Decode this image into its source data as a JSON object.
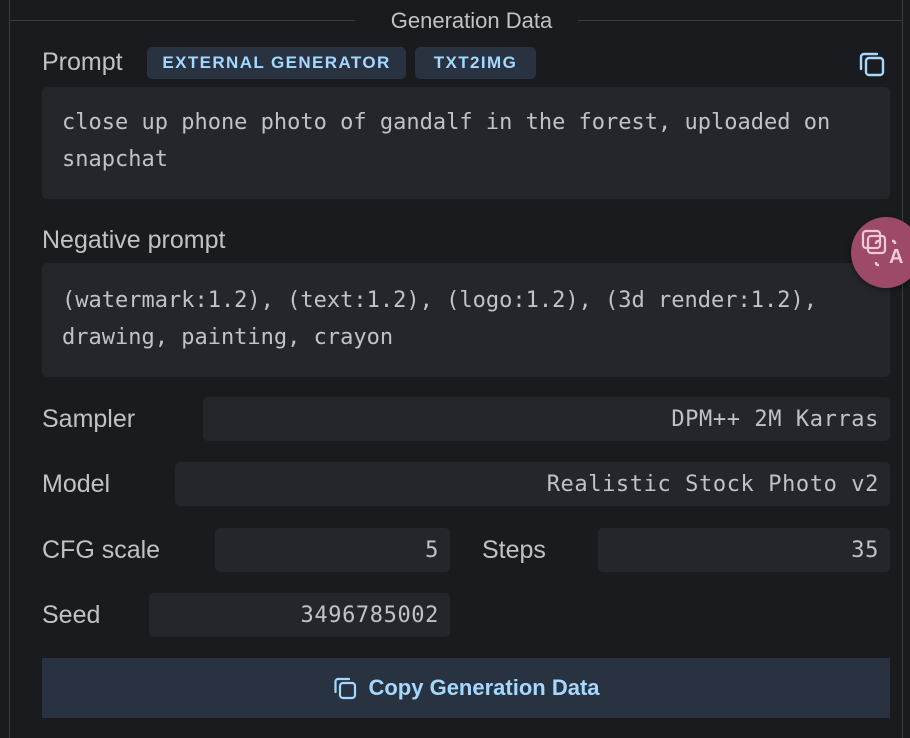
{
  "section": {
    "title": "Generation Data"
  },
  "prompt": {
    "label": "Prompt",
    "badges": [
      "EXTERNAL GENERATOR",
      "TXT2IMG"
    ],
    "text": "close up phone photo of gandalf in the forest, uploaded on snapchat"
  },
  "negative_prompt": {
    "label": "Negative prompt",
    "text": "(watermark:1.2), (text:1.2), (logo:1.2), (3d render:1.2), drawing, painting, crayon"
  },
  "params": {
    "sampler": {
      "label": "Sampler",
      "value": "DPM++ 2M Karras"
    },
    "model": {
      "label": "Model",
      "value": "Realistic Stock Photo v2"
    },
    "cfg": {
      "label": "CFG scale",
      "value": "5"
    },
    "steps": {
      "label": "Steps",
      "value": "35"
    },
    "seed": {
      "label": "Seed",
      "value": "3496785002"
    }
  },
  "actions": {
    "copy_all_label": "Copy Generation Data"
  },
  "icons": {
    "copy": "copy-icon",
    "translate": "translate-icon"
  },
  "colors": {
    "background": "#1a1b1e",
    "surface": "#25262b",
    "badge_bg": "#283241",
    "accent": "#a5d8ff",
    "floating": "#9c4a67"
  }
}
